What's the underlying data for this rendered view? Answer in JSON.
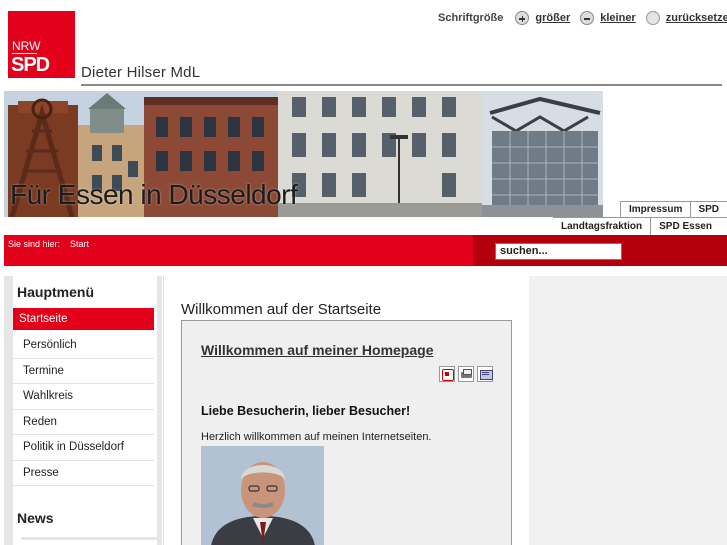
{
  "header": {
    "logo": {
      "line1": "NRW",
      "line2": "SPD"
    },
    "font_size": {
      "label": "Schriftgröße",
      "larger": "größer",
      "smaller": "kleiner",
      "reset": "zurücksetzen"
    },
    "site_title": "Dieter Hilser MdL",
    "banner_slogan": "Für Essen in Düsseldorf"
  },
  "top_links": {
    "row1": [
      "Impressum",
      "SPD"
    ],
    "row2": [
      "Landtagsfraktion",
      "SPD Essen"
    ]
  },
  "breadcrumb": {
    "label": "Sie sind hier:",
    "current": "Start"
  },
  "search": {
    "value": "suchen..."
  },
  "sidebar": {
    "title": "Hauptmenü",
    "items": [
      {
        "label": "Startseite",
        "active": true
      },
      {
        "label": "Persönlich"
      },
      {
        "label": "Termine"
      },
      {
        "label": "Wahlkreis"
      },
      {
        "label": "Reden"
      },
      {
        "label": "Politik in Düsseldorf"
      },
      {
        "label": "Presse"
      }
    ],
    "news_title": "News"
  },
  "main": {
    "title": "Willkommen auf der Startseite",
    "article": {
      "heading": "Willkommen auf meiner Homepage",
      "icons": [
        "pdf-icon",
        "print-icon",
        "email-icon"
      ],
      "greeting": "Liebe Besucherin, lieber Besucher!",
      "text": "Herzlich willkommen auf meinen Internetseiten."
    }
  },
  "colors": {
    "spd_red": "#e2001a",
    "dark_red": "#b4000d",
    "grey_panel": "#efefef"
  }
}
